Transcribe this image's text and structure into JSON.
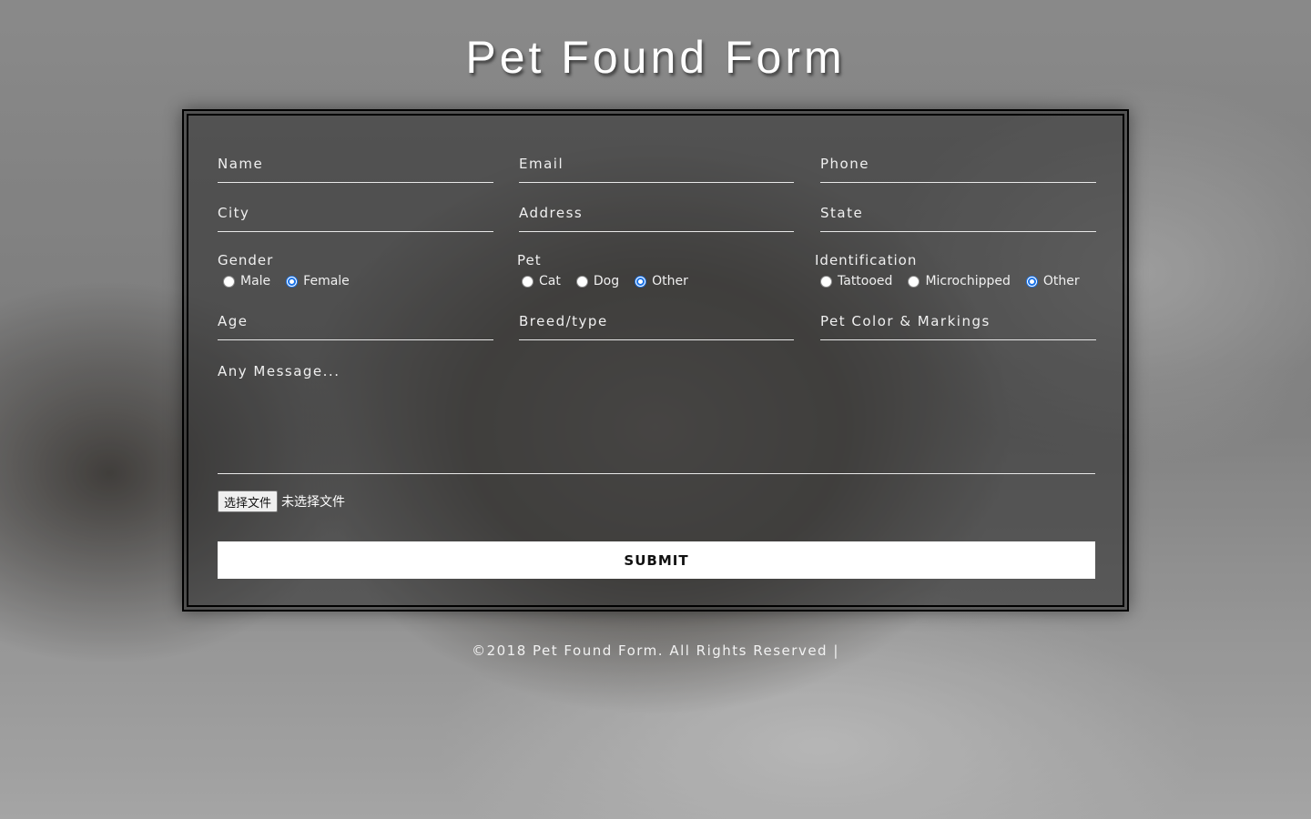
{
  "title": "Pet Found Form",
  "fields": {
    "name": "Name",
    "email": "Email",
    "phone": "Phone",
    "city": "City",
    "address": "Address",
    "state": "State",
    "age": "Age",
    "breed": "Breed/type",
    "color": "Pet Color & Markings",
    "message": "Any Message..."
  },
  "gender": {
    "label": "Gender",
    "options": [
      "Male",
      "Female"
    ],
    "selected": "Female"
  },
  "pet": {
    "label": "Pet",
    "options": [
      "Cat",
      "Dog",
      "Other"
    ],
    "selected": "Other"
  },
  "identification": {
    "label": "Identification",
    "options": [
      "Tattooed",
      "Microchipped",
      "Other"
    ],
    "selected": "Other"
  },
  "file": {
    "button_label": "选择文件",
    "status": "未选择文件"
  },
  "submit_label": "SUBMIT",
  "footer": "©2018 Pet Found Form. All Rights Reserved |",
  "colors": {
    "radio_accent": "#1a73e8",
    "submit_bg": "#ffffff"
  }
}
